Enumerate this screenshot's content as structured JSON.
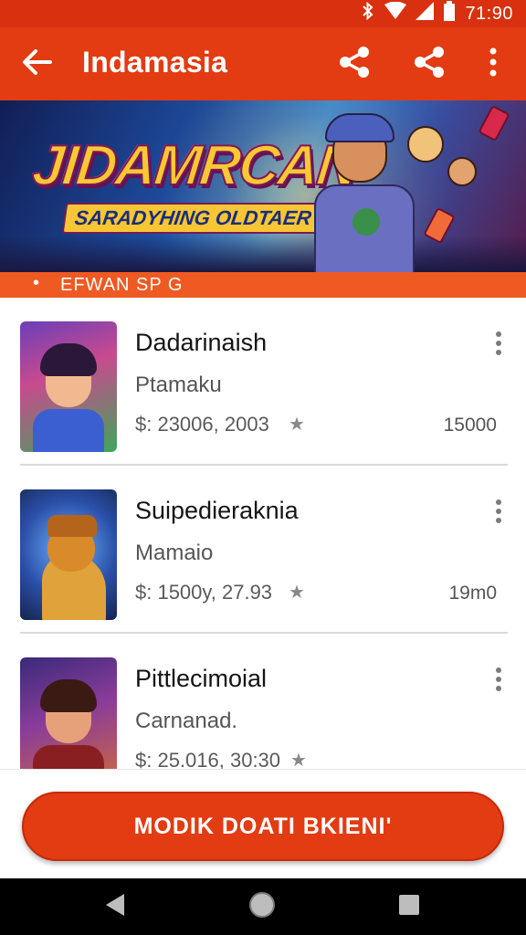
{
  "status_bar": {
    "time": "71:90",
    "icons": [
      "bluetooth-icon",
      "wifi-icon",
      "signal-icon",
      "battery-icon"
    ]
  },
  "app_bar": {
    "title": "Indamasia",
    "icons": [
      "back-arrow-icon",
      "share-icon",
      "share-icon",
      "more-vert-icon"
    ]
  },
  "banner": {
    "title": "JIDAMRCAN",
    "subtitle": "SARADYHING OLDTAER"
  },
  "ticker": {
    "bullet": "•",
    "text": "EFWAN SP G"
  },
  "list": {
    "items": [
      {
        "title": "Dadarinaish",
        "subtitle": "Ptamaku",
        "meta": "$: 23006, 2003",
        "count": "15000"
      },
      {
        "title": "Suipedieraknia",
        "subtitle": "Mamaio",
        "meta": "$: 1500y, 27.93",
        "count": "19m0"
      },
      {
        "title": "Pittlecimoial",
        "subtitle": "Carnanad.",
        "meta": "$: 25.016, 30:30",
        "count": ""
      }
    ]
  },
  "cta": {
    "label": "MODIK DOATI BKIENI'"
  },
  "colors": {
    "brand_red": "#e33b12",
    "status_red": "#d9300f",
    "ticker_orange": "#ee5a22"
  }
}
